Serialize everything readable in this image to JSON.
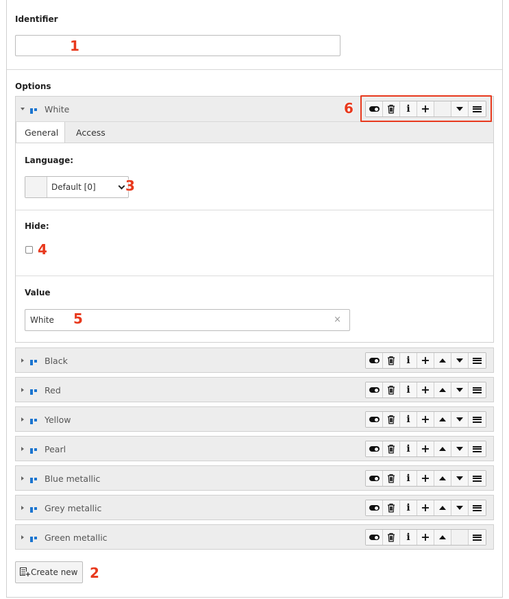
{
  "identifier": {
    "label": "Identifier",
    "value": ""
  },
  "options": {
    "label": "Options",
    "expanded": {
      "title": "White",
      "tabs": [
        {
          "label": "General",
          "active": true
        },
        {
          "label": "Access",
          "active": false
        }
      ],
      "fields": {
        "language_label": "Language:",
        "language_value": "Default [0]",
        "hide_label": "Hide:",
        "hide_checked": false,
        "value_label": "Value",
        "value_value": "White",
        "clear_glyph": "×"
      }
    },
    "collapsed": [
      {
        "title": "Black",
        "up": true,
        "down": true
      },
      {
        "title": "Red",
        "up": true,
        "down": true
      },
      {
        "title": "Yellow",
        "up": true,
        "down": true
      },
      {
        "title": "Pearl",
        "up": true,
        "down": true
      },
      {
        "title": "Blue metallic",
        "up": true,
        "down": true
      },
      {
        "title": "Grey metallic",
        "up": true,
        "down": true
      },
      {
        "title": "Green metallic",
        "up": true,
        "down": false
      }
    ],
    "button_icons": [
      "toggle-icon",
      "trash-icon",
      "info-icon",
      "plus-icon",
      "arrow-up-icon",
      "arrow-down-icon",
      "drag-handle-icon"
    ],
    "info_glyph": "i",
    "plus_glyph": "+"
  },
  "create_new": {
    "label": "Create new",
    "icon": "new-record-icon",
    "plus_glyph": "+"
  },
  "annotations": [
    "1",
    "2",
    "3",
    "4",
    "5",
    "6"
  ],
  "colors": {
    "annotation": "#e8391d",
    "drag_dots": "#1b75d0",
    "panel_bg": "#ededed"
  }
}
